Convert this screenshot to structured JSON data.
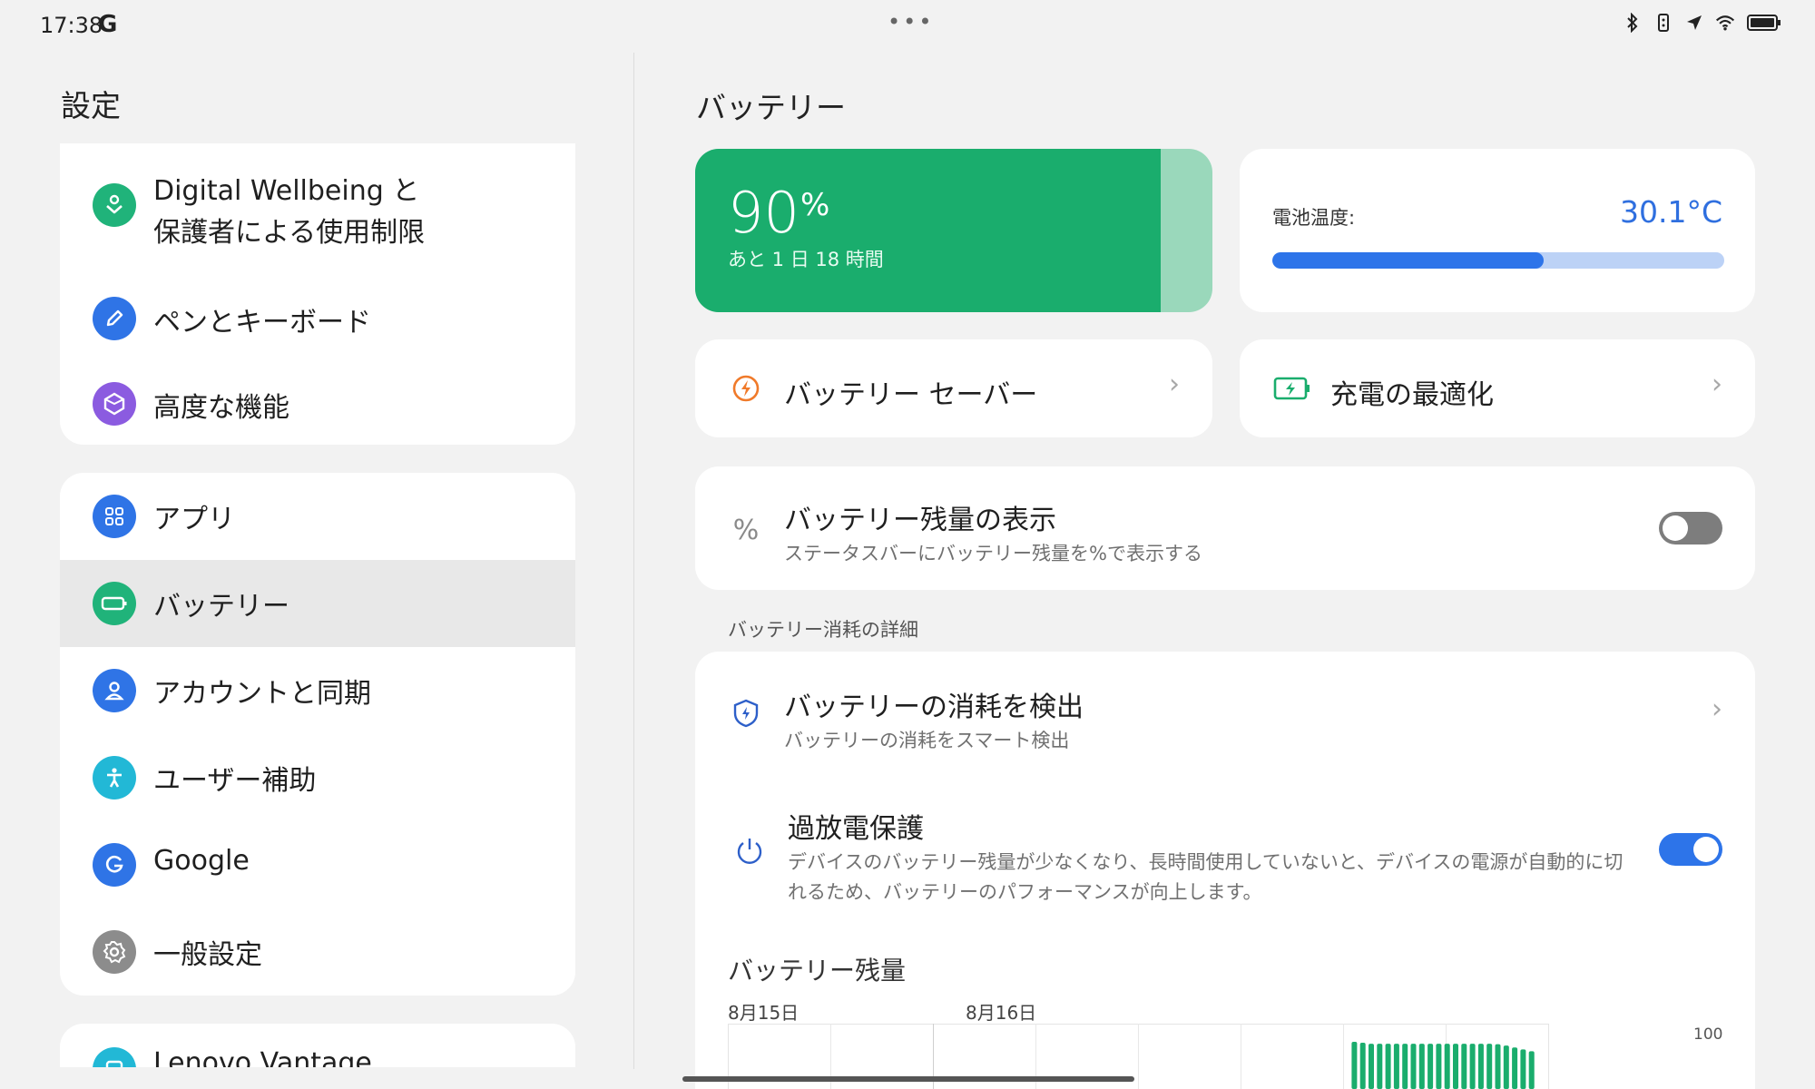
{
  "status_bar": {
    "time": "17:38",
    "google_letter": "G",
    "dots": "•••",
    "icons": [
      "bluetooth-icon",
      "vibrate-icon",
      "location-icon",
      "wifi-icon",
      "battery-full-icon"
    ]
  },
  "sidebar": {
    "title": "設定",
    "group1": [
      {
        "label_line1": "Digital Wellbeing と",
        "label_line2": "保護者による使用制限",
        "icon": "wellbeing-icon",
        "color": "#20b37a"
      },
      {
        "label": "ペンとキーボード",
        "icon": "pen-icon",
        "color": "#2f74e6"
      },
      {
        "label": "高度な機能",
        "icon": "hexagon-icon",
        "color": "#8b5be0"
      }
    ],
    "group2": [
      {
        "label": "アプリ",
        "icon": "apps-grid-icon",
        "color": "#2f74e6"
      },
      {
        "label": "バッテリー",
        "icon": "battery-icon",
        "color": "#20b37a",
        "selected": true
      },
      {
        "label": "アカウントと同期",
        "icon": "account-icon",
        "color": "#2f74e6"
      },
      {
        "label": "ユーザー補助",
        "icon": "accessibility-icon",
        "color": "#22b8d6"
      },
      {
        "label": "Google",
        "icon": "google-icon",
        "color": "#2f74e6"
      },
      {
        "label": "一般設定",
        "icon": "gear-icon",
        "color": "#8c8c8c"
      }
    ],
    "group3": [
      {
        "label": "Lenovo Vantage",
        "icon": "vantage-icon",
        "color": "#22b8d6"
      }
    ]
  },
  "main": {
    "title": "バッテリー",
    "battery": {
      "percent": "90",
      "percent_sign": "%",
      "level_fraction": 0.9,
      "remaining": "あと 1 日 18 時間",
      "fill_color": "#1aad6d"
    },
    "temperature": {
      "label": "電池温度:",
      "value": "30.1°C",
      "level_fraction": 0.6,
      "accent": "#2d74e9"
    },
    "saver": {
      "label": "バッテリー セーバー",
      "icon": "battery-saver-icon"
    },
    "optimize": {
      "label": "充電の最適化",
      "icon": "charge-optimize-icon"
    },
    "percent_display": {
      "icon_text": "%",
      "title": "バッテリー残量の表示",
      "subtitle": "ステータスバーにバッテリー残量を%で表示する",
      "enabled": false
    },
    "section_header": "バッテリー消耗の詳細",
    "drain_detect": {
      "title": "バッテリーの消耗を検出",
      "subtitle": "バッテリーの消耗をスマート検出",
      "icon": "shield-bolt-icon"
    },
    "over_discharge": {
      "title": "過放電保護",
      "subtitle_line1": "デバイスのバッテリー残量が少なくなり、長時間使用していないと、デバイスの電源が自動的に切",
      "subtitle_line2": "れるため、バッテリーのパフォーマンスが向上します。",
      "icon": "power-icon",
      "enabled": true
    },
    "level_chart": {
      "title": "バッテリー残量",
      "dates": [
        "8月15日",
        "8月16日"
      ],
      "axis_max_label": "100",
      "bar_levels": [
        100,
        98,
        96,
        96,
        96,
        96,
        96,
        96,
        96,
        96,
        96,
        96,
        96,
        96,
        96,
        96,
        96,
        95,
        92,
        88,
        84,
        80
      ],
      "bar_color": "#1aad6d"
    }
  }
}
